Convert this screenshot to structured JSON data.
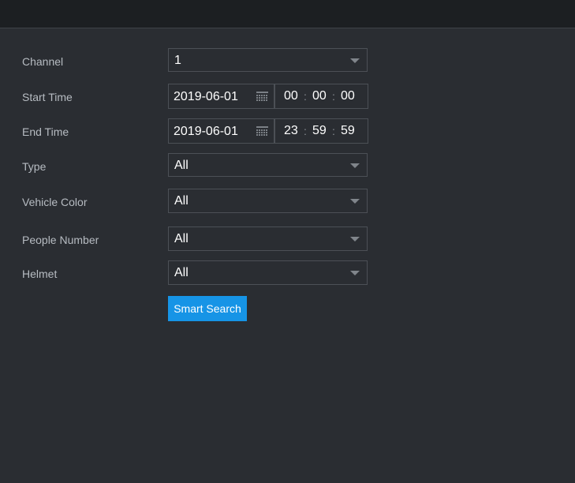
{
  "form": {
    "channel": {
      "label": "Channel",
      "value": "1"
    },
    "start_time": {
      "label": "Start Time",
      "date": "2019-06-01",
      "hour": "00",
      "minute": "00",
      "second": "00",
      "sep": ":"
    },
    "end_time": {
      "label": "End Time",
      "date": "2019-06-01",
      "hour": "23",
      "minute": "59",
      "second": "59",
      "sep": ":"
    },
    "type": {
      "label": "Type",
      "value": "All"
    },
    "vehicle_color": {
      "label": "Vehicle Color",
      "value": "All"
    },
    "people_number": {
      "label": "People Number",
      "value": "All"
    },
    "helmet": {
      "label": "Helmet",
      "value": "All"
    }
  },
  "actions": {
    "smart_search_label": "Smart Search"
  },
  "icons": {
    "dropdown": "chevron-down-icon",
    "date_picker": "calendar-icon"
  },
  "colors": {
    "accent": "#1694e6",
    "background": "#2a2d32",
    "topbar": "#1c1f22"
  }
}
